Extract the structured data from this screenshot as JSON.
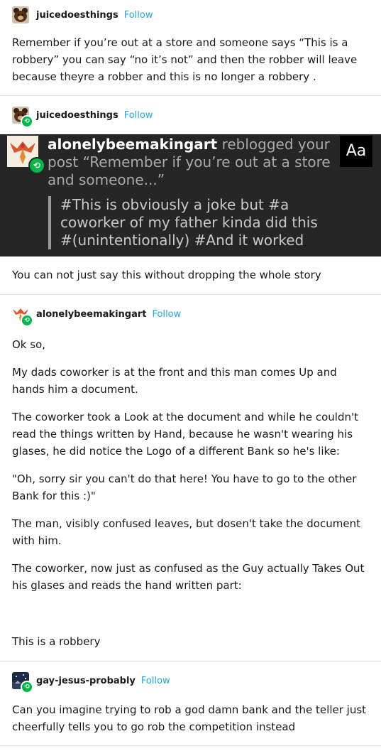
{
  "posts": [
    {
      "username": "juicedoesthings",
      "follow": "Follow",
      "text": "Remember if you’re out at a store and  someone says “This is a robbery” you can say “no it’s not” and then the robber will leave because theyre a robber and this is no longer a robbery ."
    },
    {
      "username": "juicedoesthings",
      "follow": "Follow",
      "notification": {
        "user": "alonelybeemakingart",
        "action": "reblogged your post",
        "post_quote": "“Remember if you’re out at a store and someone...”",
        "tags": "#This is obviously a joke but #a coworker of my father kinda did this #(unintentionally) #And it worked",
        "aa_label": "Aa"
      },
      "text": "You can not just say this without dropping the whole story"
    },
    {
      "username": "alonelybeemakingart",
      "follow": "Follow",
      "paragraphs": [
        "Ok so,",
        "My dads coworker is at the front and this man comes Up and hands him a document.",
        "The coworker took a Look at the document and while he couldn't read the things written by Hand, because he wasn't wearing his glases, he did notice the Logo of a different Bank so he's like:",
        "\"Oh, sorry sir you can't do that here! You have to go to the other Bank for this :)\"",
        "The man, visibly confused leaves, but dosen't take the document with him.",
        "The coworker, now just as confused as the Guy actually Takes Out his glases and reads the hand written part:",
        "This is a robbery"
      ]
    },
    {
      "username": "gay-jesus-probably",
      "follow": "Follow",
      "text": "Can you imagine trying to rob a god damn bank and the teller just cheerfully tells you to go rob the competition instead"
    }
  ],
  "colors": {
    "follow": "#1ea6e6",
    "reblog_badge": "#00b84a",
    "notification_bg": "#262626"
  },
  "icons": {
    "avatar_juice": "bear-avatar-icon",
    "avatar_bee": "phoenix-avatar-icon",
    "avatar_gay": "night-sky-avatar-icon",
    "reblog": "reblog-icon"
  }
}
